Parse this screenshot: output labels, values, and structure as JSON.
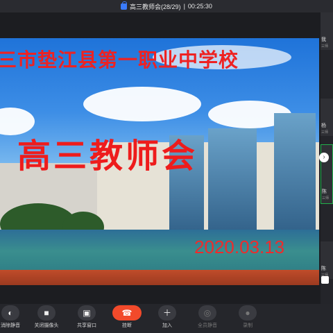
{
  "topbar": {
    "meeting_title": "高三教师会(28/29)",
    "separator": "|",
    "timer": "00:25:30"
  },
  "shared_screen": {
    "school_name": "三市垫江县第一职业中学校",
    "meeting_title": "高三教师会",
    "date": "2020.03.13"
  },
  "sidebar": {
    "participants": [
      {
        "name": "我",
        "sub": "三师"
      },
      {
        "name": "杨",
        "sub": "三师"
      },
      {
        "name": "陈",
        "sub": "三师"
      },
      {
        "name": "陈",
        "sub": "三师"
      }
    ]
  },
  "toolbar": {
    "items": [
      {
        "label": "消除静音",
        "icon": "mic-icon"
      },
      {
        "label": "关闭摄像头",
        "icon": "camera-icon"
      },
      {
        "label": "共享窗口",
        "icon": "share-window-icon"
      },
      {
        "label": "挂断",
        "icon": "hangup-icon"
      },
      {
        "label": "加入",
        "icon": "add-user-icon"
      },
      {
        "label": "全员静音",
        "icon": "mute-all-icon"
      },
      {
        "label": "录制",
        "icon": "record-icon"
      }
    ]
  },
  "colors": {
    "title_red": "#ee1c1c",
    "end_button": "#f24a2b",
    "active_border": "#21b14b"
  }
}
